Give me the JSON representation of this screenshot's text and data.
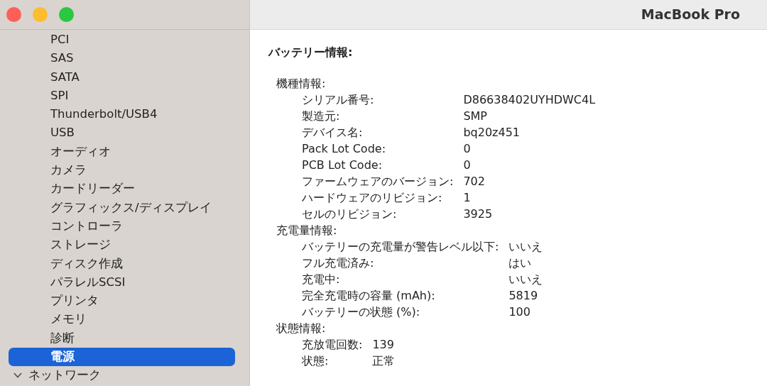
{
  "window": {
    "title": "MacBook Pro"
  },
  "sidebar": {
    "items": [
      {
        "kind": "item",
        "label": "PCI",
        "selected": false
      },
      {
        "kind": "item",
        "label": "SAS",
        "selected": false
      },
      {
        "kind": "item",
        "label": "SATA",
        "selected": false
      },
      {
        "kind": "item",
        "label": "SPI",
        "selected": false
      },
      {
        "kind": "item",
        "label": "Thunderbolt/USB4",
        "selected": false
      },
      {
        "kind": "item",
        "label": "USB",
        "selected": false
      },
      {
        "kind": "item",
        "label": "オーディオ",
        "selected": false
      },
      {
        "kind": "item",
        "label": "カメラ",
        "selected": false
      },
      {
        "kind": "item",
        "label": "カードリーダー",
        "selected": false
      },
      {
        "kind": "item",
        "label": "グラフィックス/ディスプレイ",
        "selected": false
      },
      {
        "kind": "item",
        "label": "コントローラ",
        "selected": false
      },
      {
        "kind": "item",
        "label": "ストレージ",
        "selected": false
      },
      {
        "kind": "item",
        "label": "ディスク作成",
        "selected": false
      },
      {
        "kind": "item",
        "label": "パラレルSCSI",
        "selected": false
      },
      {
        "kind": "item",
        "label": "プリンタ",
        "selected": false
      },
      {
        "kind": "item",
        "label": "メモリ",
        "selected": false
      },
      {
        "kind": "item",
        "label": "診断",
        "selected": false
      },
      {
        "kind": "item",
        "label": "電源",
        "selected": true
      },
      {
        "kind": "group",
        "label": "ネットワーク",
        "selected": false,
        "expanded": true
      }
    ]
  },
  "content": {
    "heading": "バッテリー情報:",
    "sections": [
      {
        "title": "機種情報:",
        "rows": [
          {
            "label": "シリアル番号:",
            "value": "D86638402UYHDWC4L"
          },
          {
            "label": "製造元:",
            "value": "SMP"
          },
          {
            "label": "デバイス名:",
            "value": "bq20z451"
          },
          {
            "label": "Pack Lot Code:",
            "value": "0"
          },
          {
            "label": "PCB Lot Code:",
            "value": "0"
          },
          {
            "label": "ファームウェアのバージョン:",
            "value": "702"
          },
          {
            "label": "ハードウェアのリビジョン:",
            "value": "1"
          },
          {
            "label": "セルのリビジョン:",
            "value": "3925"
          }
        ]
      },
      {
        "title": "充電量情報:",
        "rows": [
          {
            "label": "バッテリーの充電量が警告レベル以下:",
            "value": "いいえ"
          },
          {
            "label": "フル充電済み:",
            "value": "はい"
          },
          {
            "label": "充電中:",
            "value": "いいえ"
          },
          {
            "label": "完全充電時の容量 (mAh):",
            "value": "5819"
          },
          {
            "label": "バッテリーの状態 (%):",
            "value": "100"
          }
        ]
      },
      {
        "title": "状態情報:",
        "rows": [
          {
            "label": "充放電回数:",
            "value": "139"
          },
          {
            "label": "状態:",
            "value": "正常"
          }
        ]
      }
    ]
  }
}
